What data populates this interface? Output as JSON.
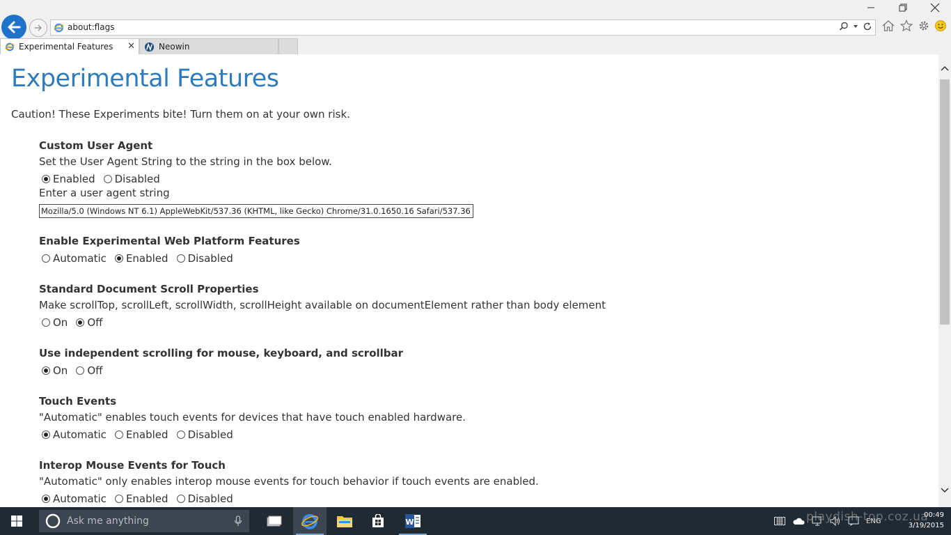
{
  "browser": {
    "address_url": "about:flags",
    "tabs": [
      {
        "label": "Experimental Features",
        "active": true
      },
      {
        "label": "Neowin",
        "active": false
      }
    ],
    "accent_color": "#1e73c8"
  },
  "page": {
    "title": "Experimental Features",
    "caution": "Caution! These Experiments bite! Turn them on at your own risk.",
    "title_color": "#2e7bbf",
    "features": [
      {
        "title": "Custom User Agent",
        "description": "Set the User Agent String to the string in the box below.",
        "options": [
          {
            "label": "Enabled",
            "checked": true
          },
          {
            "label": "Disabled",
            "checked": false
          }
        ],
        "input_label": "Enter a user agent string",
        "input_value": "Mozilla/5.0 (Windows NT 6.1) AppleWebKit/537.36 (KHTML, like Gecko) Chrome/31.0.1650.16 Safari/537.36"
      },
      {
        "title": "Enable Experimental Web Platform Features",
        "options": [
          {
            "label": "Automatic",
            "checked": false
          },
          {
            "label": "Enabled",
            "checked": true
          },
          {
            "label": "Disabled",
            "checked": false
          }
        ]
      },
      {
        "title": "Standard Document Scroll Properties",
        "description": "Make scrollTop, scrollLeft, scrollWidth, scrollHeight available on documentElement rather than body element",
        "options": [
          {
            "label": "On",
            "checked": false
          },
          {
            "label": "Off",
            "checked": true
          }
        ]
      },
      {
        "title": "Use independent scrolling for mouse, keyboard, and scrollbar",
        "options": [
          {
            "label": "On",
            "checked": true
          },
          {
            "label": "Off",
            "checked": false
          }
        ]
      },
      {
        "title": "Touch Events",
        "description": "\"Automatic\" enables touch events for devices that have touch enabled hardware.",
        "options": [
          {
            "label": "Automatic",
            "checked": true
          },
          {
            "label": "Enabled",
            "checked": false
          },
          {
            "label": "Disabled",
            "checked": false
          }
        ]
      },
      {
        "title": "Interop Mouse Events for Touch",
        "description": "\"Automatic\" only enables interop mouse events for touch behavior if touch events are enabled.",
        "options": [
          {
            "label": "Automatic",
            "checked": true
          },
          {
            "label": "Enabled",
            "checked": false
          },
          {
            "label": "Disabled",
            "checked": false
          }
        ]
      }
    ]
  },
  "taskbar": {
    "search_placeholder": "Ask me anything",
    "language": "ENG",
    "time": "00:49",
    "date": "3/19/2015",
    "apps": [
      "task-view",
      "internet-explorer",
      "file-explorer",
      "store",
      "word"
    ],
    "background_color": "#1f2a33"
  },
  "watermark": "playdish-top.coz.ua"
}
